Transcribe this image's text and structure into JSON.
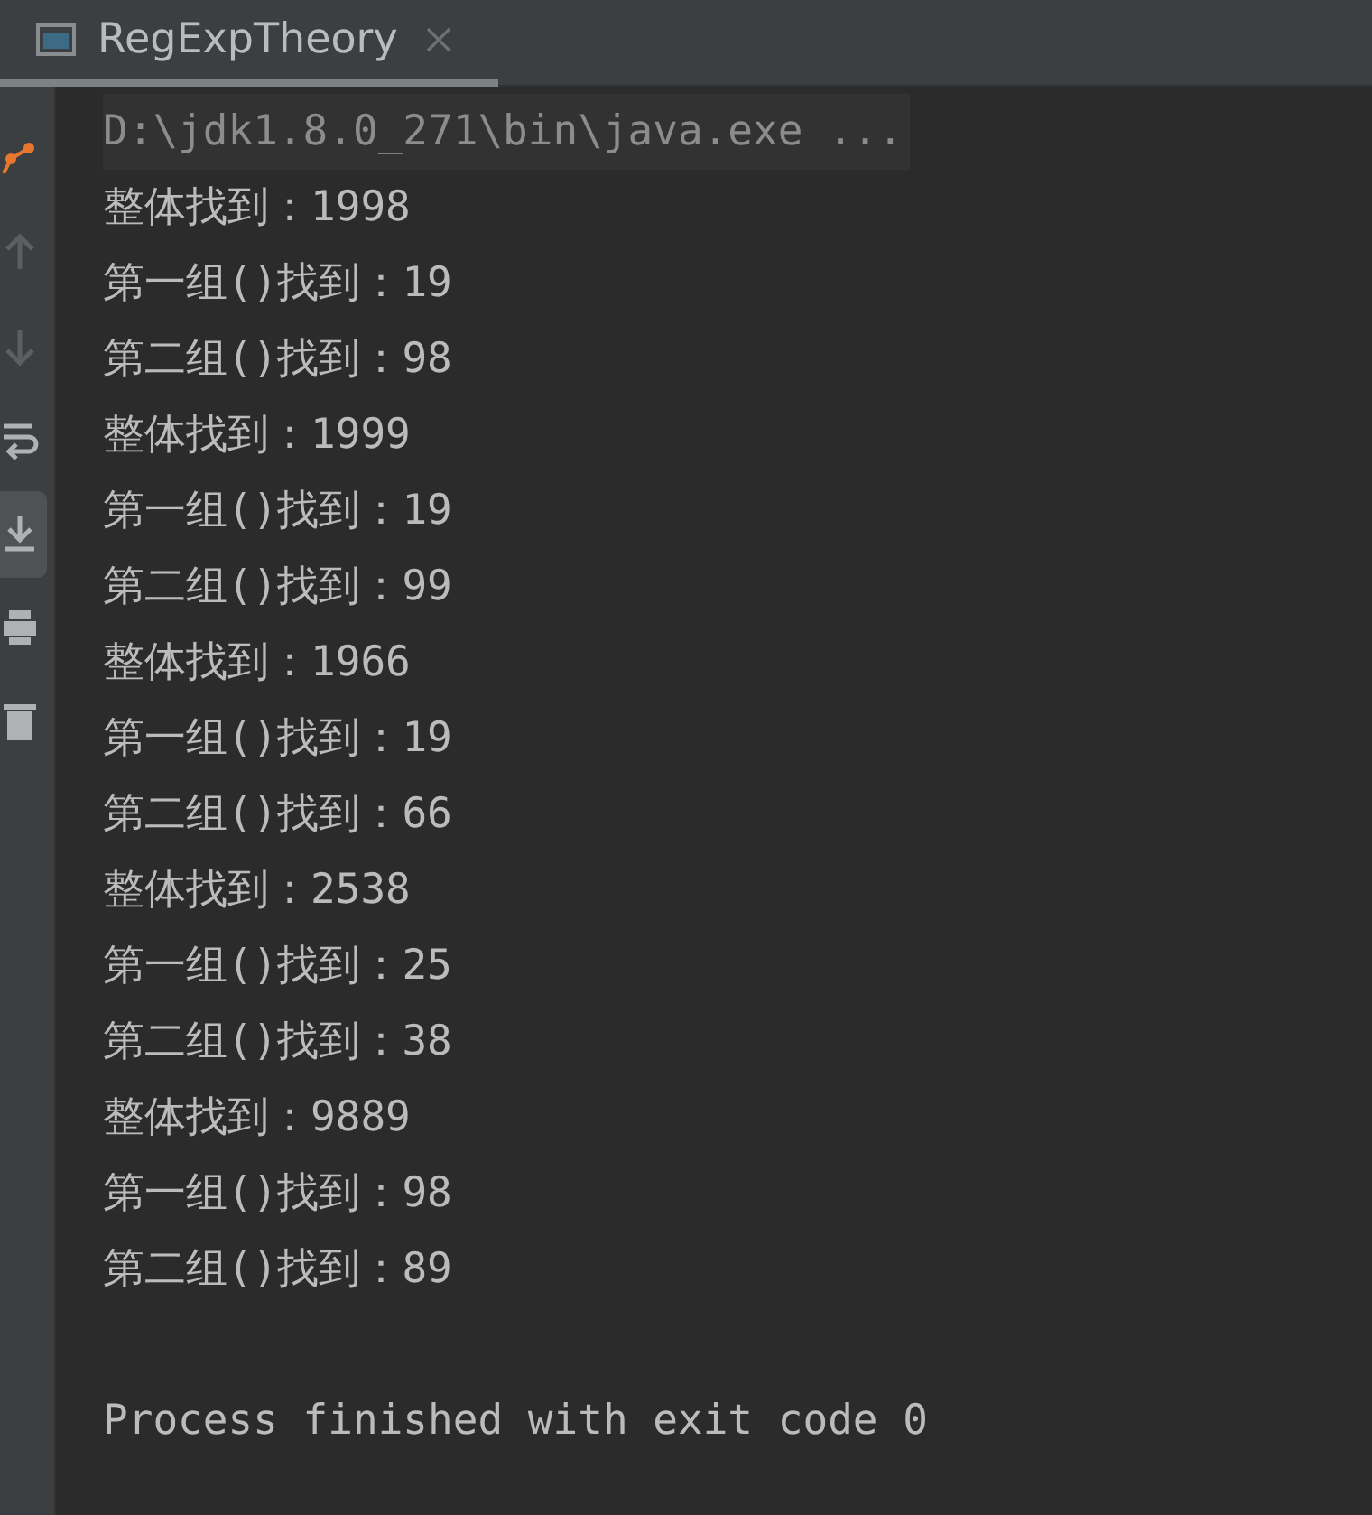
{
  "tab": {
    "title": "RegExpTheory",
    "selected": true
  },
  "toolbar": [
    {
      "kind": "debug",
      "selected": false
    },
    {
      "kind": "up",
      "selected": false
    },
    {
      "kind": "down",
      "selected": false
    },
    {
      "kind": "wrap",
      "selected": false
    },
    {
      "kind": "scroll-end",
      "selected": true
    },
    {
      "kind": "print",
      "selected": false
    },
    {
      "kind": "trash",
      "selected": false
    }
  ],
  "lines": [
    {
      "kind": "command",
      "text": "D:\\jdk1.8.0_271\\bin\\java.exe ..."
    },
    {
      "kind": "output",
      "text": "整体找到：1998"
    },
    {
      "kind": "output",
      "text": "第一组()找到：19"
    },
    {
      "kind": "output",
      "text": "第二组()找到：98"
    },
    {
      "kind": "output",
      "text": "整体找到：1999"
    },
    {
      "kind": "output",
      "text": "第一组()找到：19"
    },
    {
      "kind": "output",
      "text": "第二组()找到：99"
    },
    {
      "kind": "output",
      "text": "整体找到：1966"
    },
    {
      "kind": "output",
      "text": "第一组()找到：19"
    },
    {
      "kind": "output",
      "text": "第二组()找到：66"
    },
    {
      "kind": "output",
      "text": "整体找到：2538"
    },
    {
      "kind": "output",
      "text": "第一组()找到：25"
    },
    {
      "kind": "output",
      "text": "第二组()找到：38"
    },
    {
      "kind": "output",
      "text": "整体找到：9889"
    },
    {
      "kind": "output",
      "text": "第一组()找到：98"
    },
    {
      "kind": "output",
      "text": "第二组()找到：89"
    },
    {
      "kind": "exit",
      "text": "Process finished with exit code 0"
    }
  ]
}
